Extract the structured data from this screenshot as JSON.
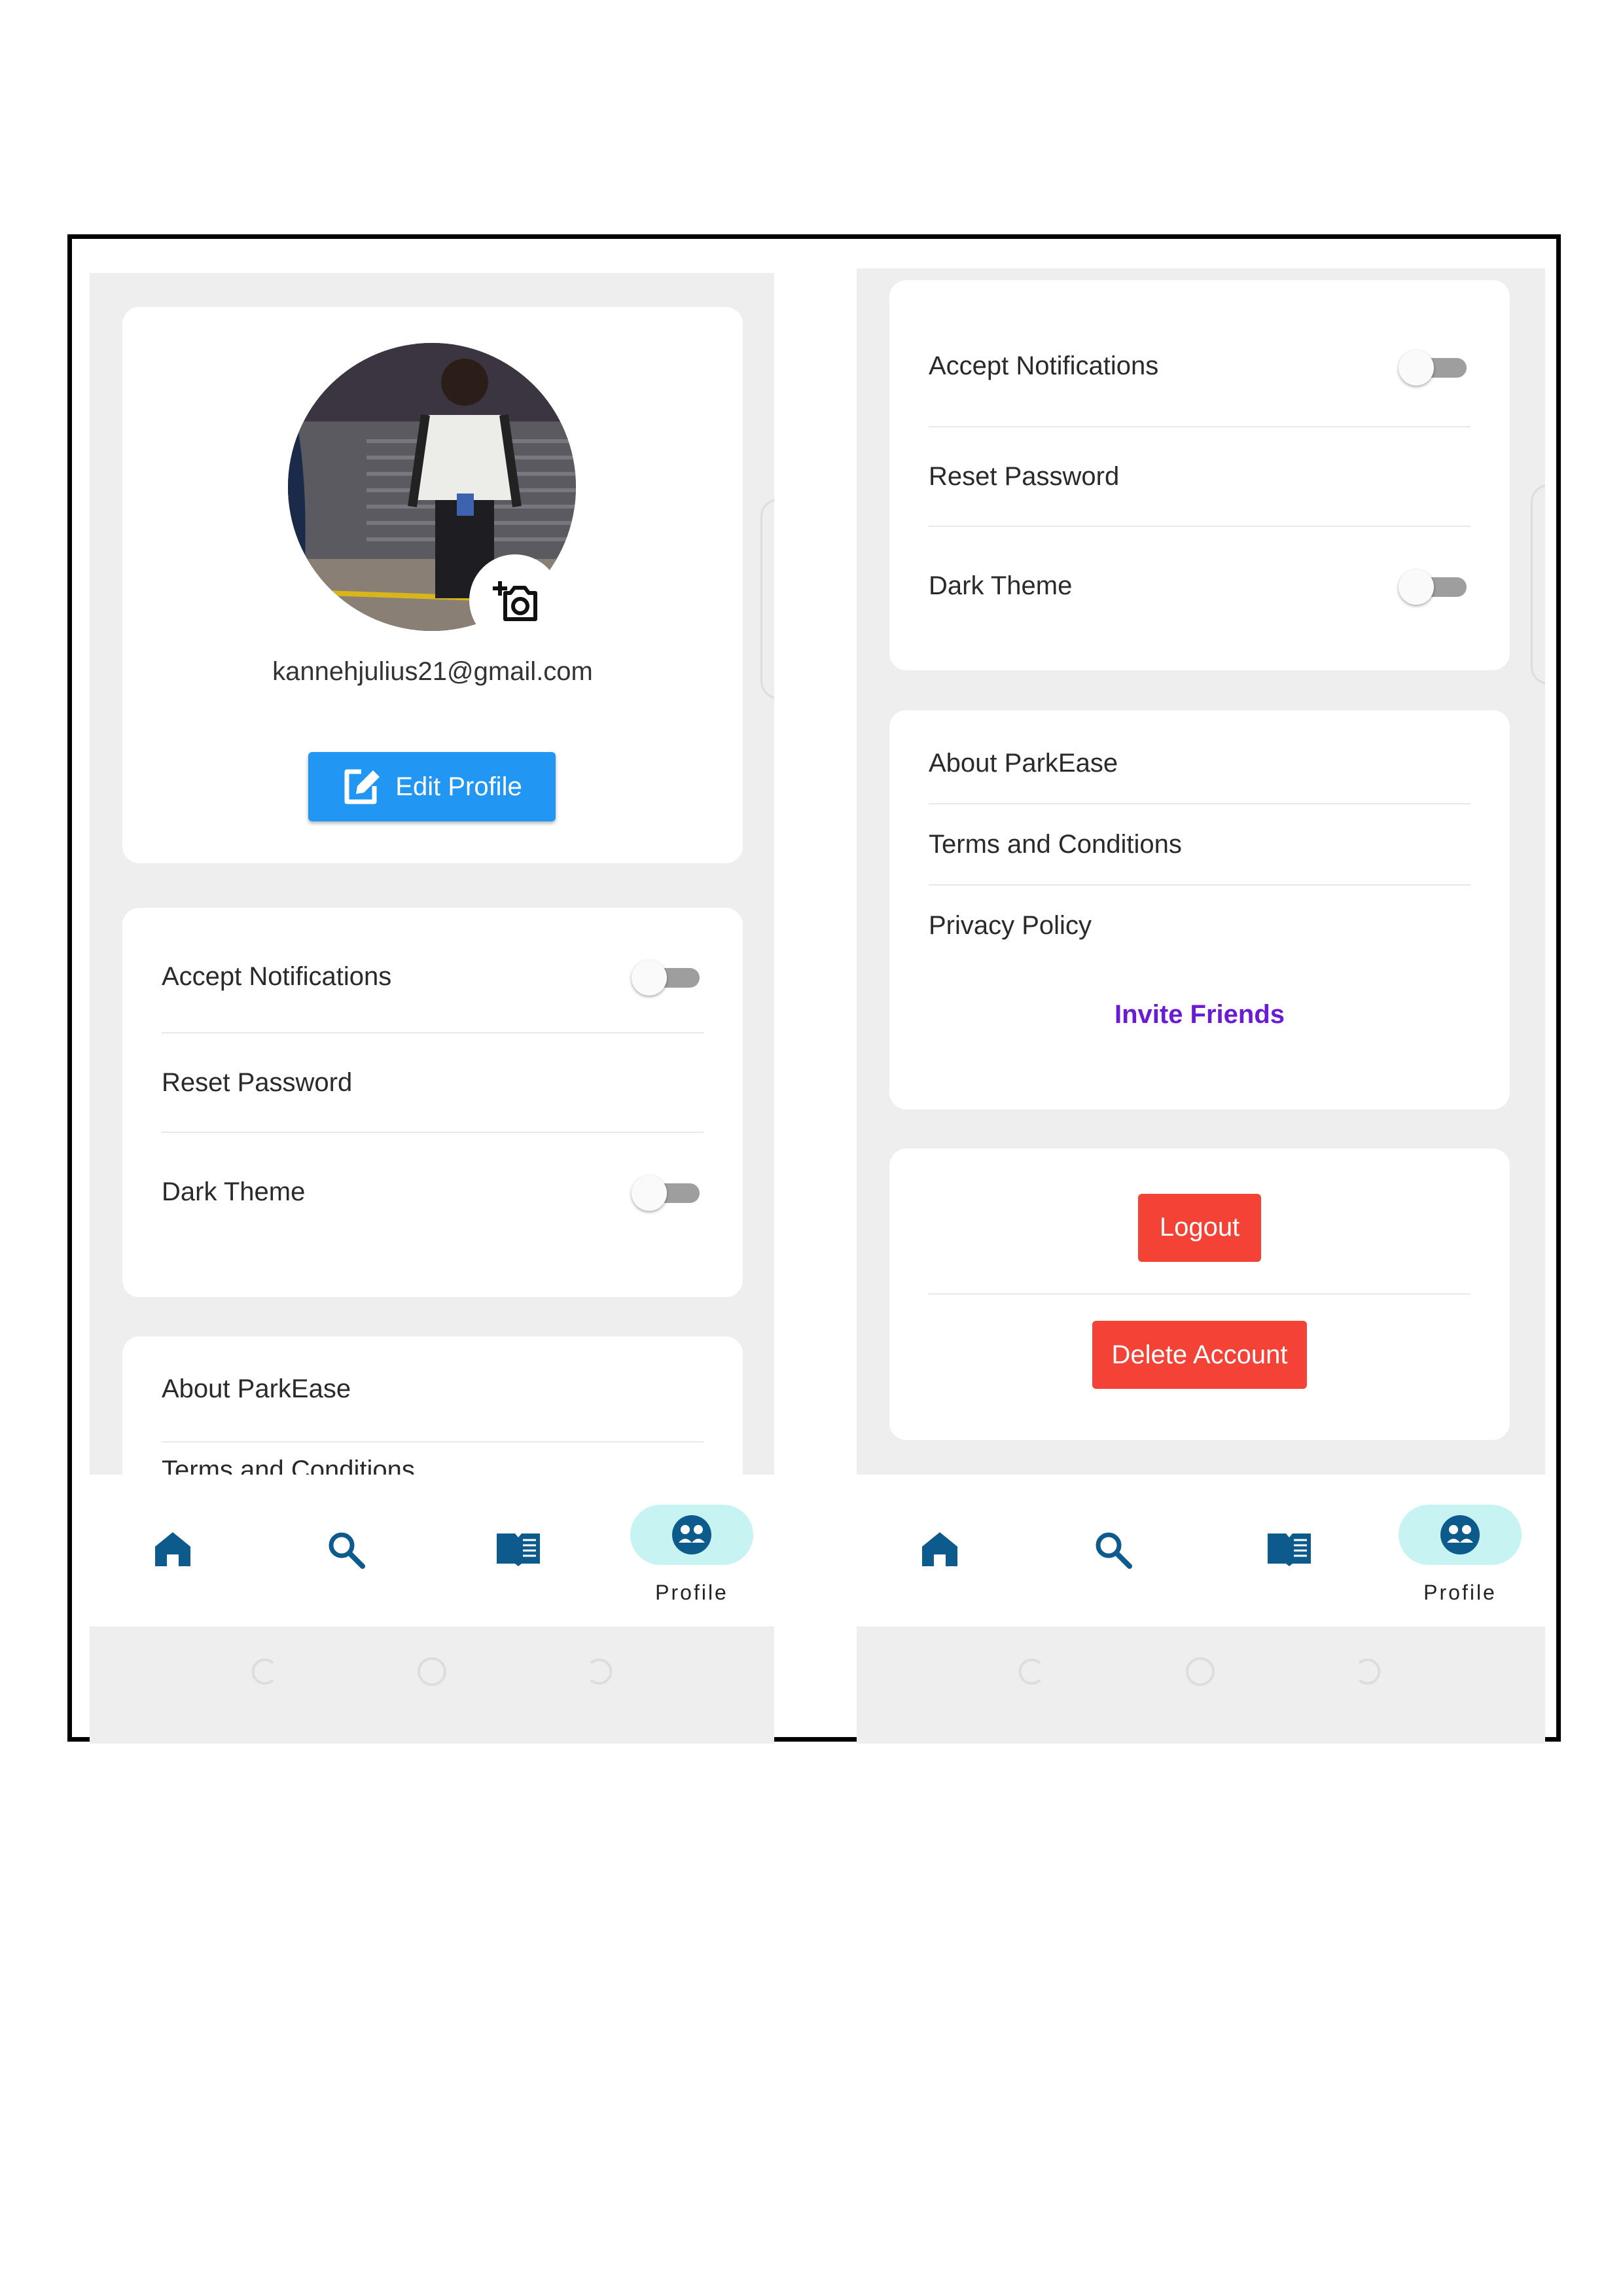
{
  "left_screen": {
    "profile": {
      "email": "kannehjulius21@gmail.com",
      "edit_button_label": "Edit Profile"
    },
    "settings": {
      "accept_notifications_label": "Accept Notifications",
      "accept_notifications_on": false,
      "reset_password_label": "Reset Password",
      "dark_theme_label": "Dark Theme",
      "dark_theme_on": false
    },
    "info": {
      "about_label": "About ParkEase",
      "terms_label": "Terms and Conditions"
    },
    "nav": {
      "items": [
        {
          "icon": "home-icon"
        },
        {
          "icon": "search-icon"
        },
        {
          "icon": "book-icon"
        },
        {
          "icon": "profile-icon",
          "label": "Profile",
          "active": true
        }
      ]
    }
  },
  "right_screen": {
    "settings": {
      "accept_notifications_label": "Accept Notifications",
      "accept_notifications_on": false,
      "reset_password_label": "Reset Password",
      "dark_theme_label": "Dark Theme",
      "dark_theme_on": false
    },
    "info": {
      "about_label": "About ParkEase",
      "terms_label": "Terms and Conditions",
      "privacy_label": "Privacy Policy",
      "invite_label": "Invite Friends"
    },
    "account": {
      "logout_label": "Logout",
      "delete_label": "Delete Account"
    },
    "nav": {
      "items": [
        {
          "icon": "home-icon"
        },
        {
          "icon": "search-icon"
        },
        {
          "icon": "book-icon"
        },
        {
          "icon": "profile-icon",
          "label": "Profile",
          "active": true
        }
      ]
    }
  },
  "colors": {
    "primary_button": "#2196f3",
    "danger": "#f44336",
    "invite_link": "#6a1bd6",
    "nav_icon": "#0d5a8c",
    "nav_active_pill": "#c8f3f3"
  }
}
